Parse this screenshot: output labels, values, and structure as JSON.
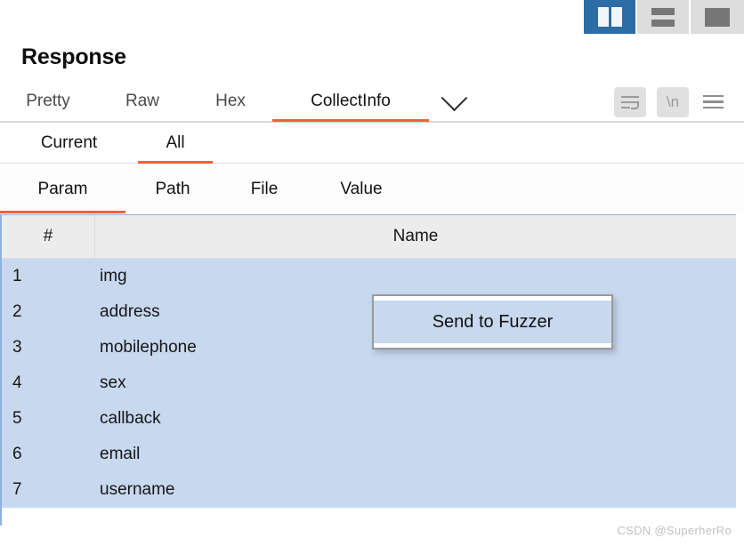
{
  "view_toggles": [
    {
      "name": "split-vertical-view",
      "icon": "split-vertical-icon",
      "active": true
    },
    {
      "name": "split-horizontal-view",
      "icon": "split-horizontal-icon",
      "active": false
    },
    {
      "name": "single-pane-view",
      "icon": "single-pane-icon",
      "active": false
    }
  ],
  "header": {
    "title": "Response"
  },
  "primary_tabs": {
    "items": [
      {
        "label": "Pretty",
        "active": false
      },
      {
        "label": "Raw",
        "active": false
      },
      {
        "label": "Hex",
        "active": false
      },
      {
        "label": "CollectInfo",
        "active": true
      }
    ],
    "dropdown_icon": "chevron-down-icon",
    "actions": [
      {
        "name": "word-wrap-button",
        "icon": "word-wrap-icon"
      },
      {
        "name": "show-newlines-button",
        "icon": "newline-icon",
        "label": "\\n"
      },
      {
        "name": "menu-button",
        "icon": "hamburger-menu-icon"
      }
    ]
  },
  "secondary_tabs": {
    "items": [
      {
        "label": "Current",
        "active": false
      },
      {
        "label": "All",
        "active": true
      }
    ]
  },
  "tertiary_tabs": {
    "items": [
      {
        "label": "Param",
        "active": true
      },
      {
        "label": "Path",
        "active": false
      },
      {
        "label": "File",
        "active": false
      },
      {
        "label": "Value",
        "active": false
      }
    ]
  },
  "table": {
    "columns": [
      "#",
      "Name"
    ],
    "rows": [
      {
        "num": "1",
        "name": "img"
      },
      {
        "num": "2",
        "name": "address"
      },
      {
        "num": "3",
        "name": "mobilephone"
      },
      {
        "num": "4",
        "name": "sex"
      },
      {
        "num": "5",
        "name": "callback"
      },
      {
        "num": "6",
        "name": "email"
      },
      {
        "num": "7",
        "name": "username"
      }
    ]
  },
  "context_menu": {
    "items": [
      {
        "label": "Send to Fuzzer",
        "highlighted": true
      }
    ]
  },
  "watermark": "CSDN @SuperherRo",
  "colors": {
    "accent_orange": "#f2603a",
    "active_toggle_blue": "#2e6ca4",
    "row_selection_blue": "#c7d8ef",
    "header_gray": "#ececec"
  }
}
